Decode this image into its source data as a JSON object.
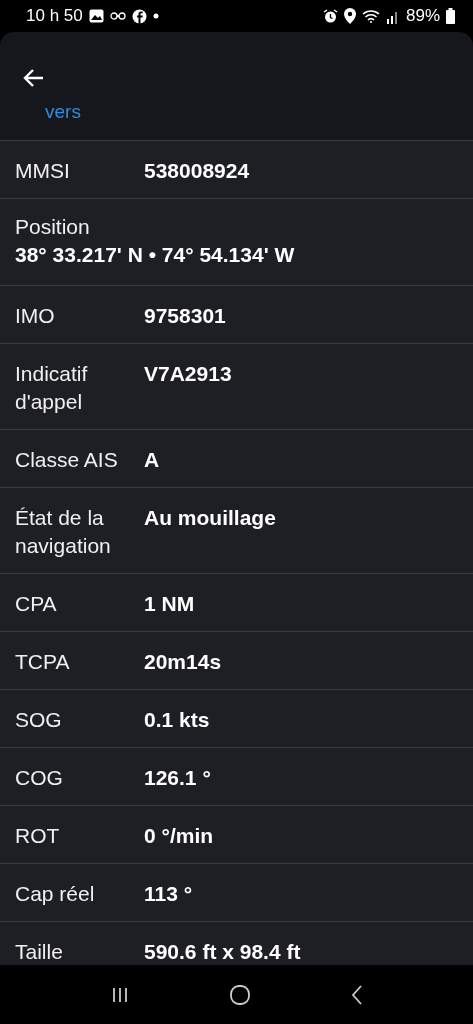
{
  "status_bar": {
    "time": "10 h 50",
    "battery": "89%"
  },
  "header": {
    "link": "vers"
  },
  "rows": [
    {
      "kind": "pair",
      "label": "MMSI",
      "value": "538008924"
    },
    {
      "kind": "stacked",
      "label": "Position",
      "value": "38° 33.217' N • 74° 54.134' W"
    },
    {
      "kind": "pair",
      "label": "IMO",
      "value": "9758301"
    },
    {
      "kind": "pair",
      "label": "Indicatif d'appel",
      "value": "V7A2913"
    },
    {
      "kind": "pair",
      "label": "Classe AIS",
      "value": "A"
    },
    {
      "kind": "pair",
      "label": "État de la navigation",
      "value": "Au mouillage"
    },
    {
      "kind": "pair",
      "label": "CPA",
      "value": "1 NM"
    },
    {
      "kind": "pair",
      "label": "TCPA",
      "value": "20m14s"
    },
    {
      "kind": "pair",
      "label": "SOG",
      "value": "0.1 kts"
    },
    {
      "kind": "pair",
      "label": "COG",
      "value": "126.1 °"
    },
    {
      "kind": "pair",
      "label": "ROT",
      "value": "0 °/min"
    },
    {
      "kind": "pair",
      "label": "Cap réel",
      "value": "113 °"
    },
    {
      "kind": "pair",
      "label": "Taille",
      "value": "590.6 ft x 98.4 ft"
    }
  ]
}
